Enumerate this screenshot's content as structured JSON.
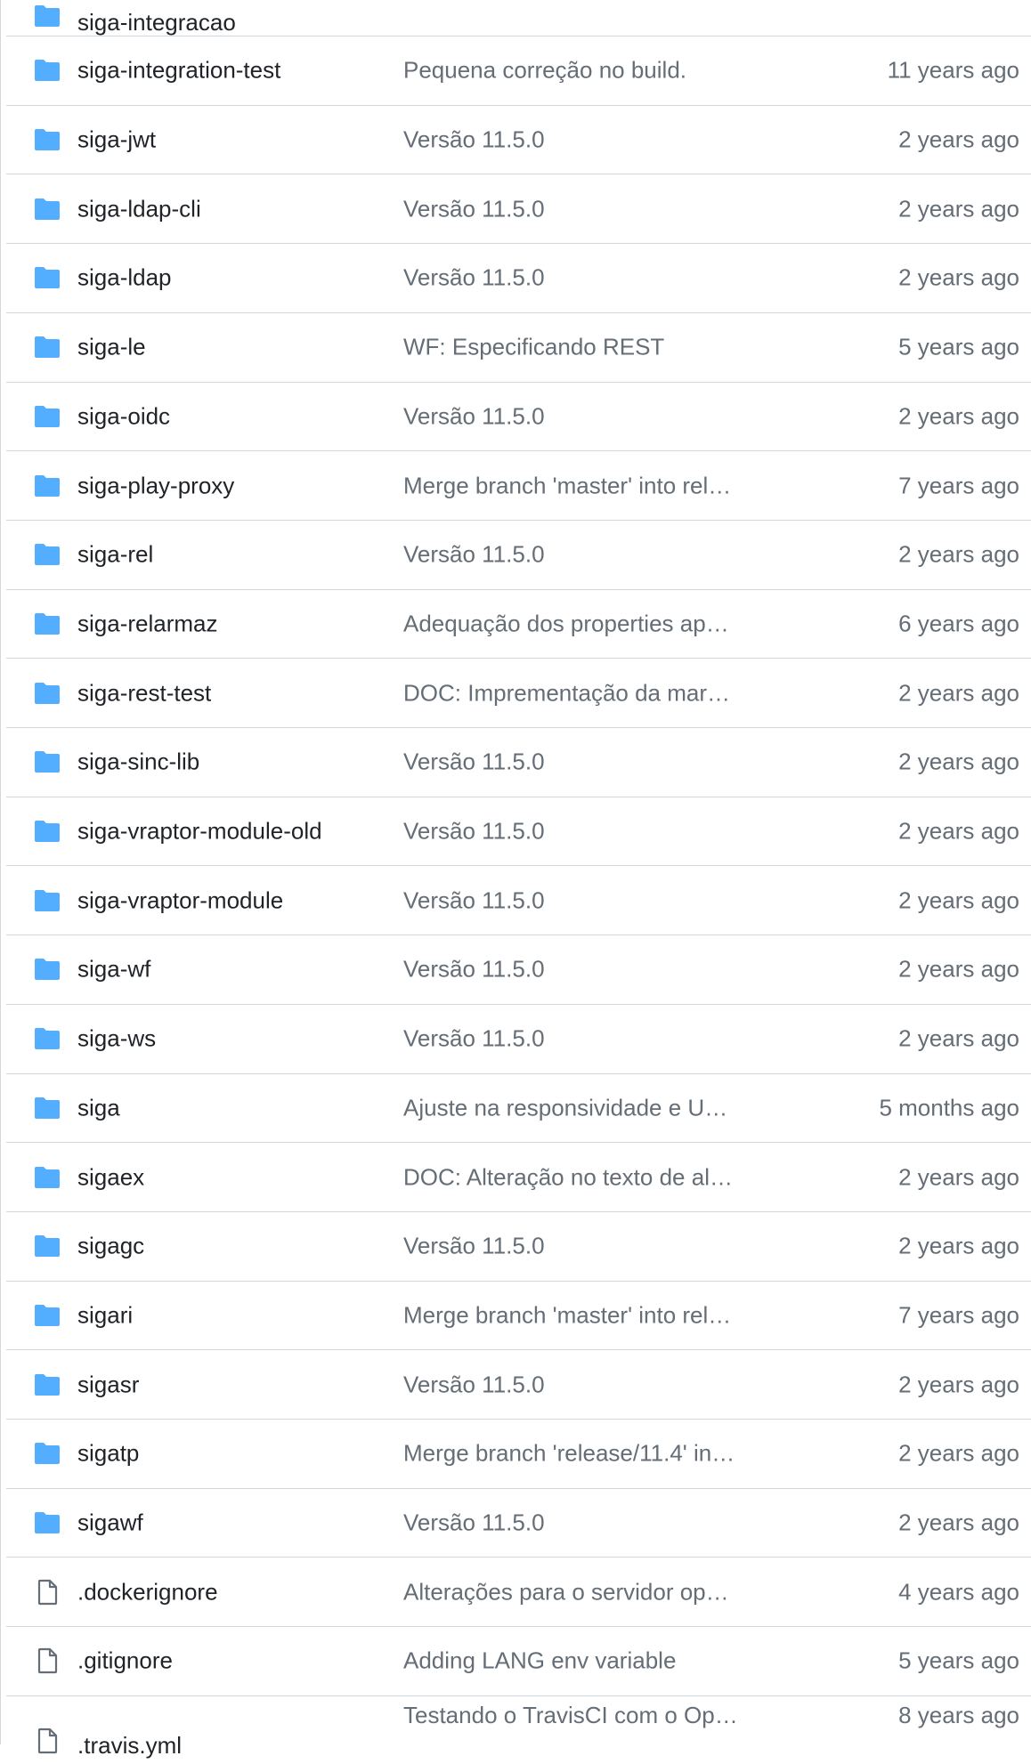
{
  "colors": {
    "folder_icon": "#54aeff",
    "file_icon": "#656d76",
    "border": "#d0d7de",
    "text_primary": "#1f2328",
    "text_muted": "#656d76"
  },
  "partial_top_item": {
    "name": "siga-integracao",
    "icon": "folder-icon"
  },
  "rows": [
    {
      "name": "siga-integration-test",
      "icon": "folder-icon",
      "message": "Pequena correção no build.",
      "age": "11 years ago"
    },
    {
      "name": "siga-jwt",
      "icon": "folder-icon",
      "message": "Versão 11.5.0",
      "age": "2 years ago"
    },
    {
      "name": "siga-ldap-cli",
      "icon": "folder-icon",
      "message": "Versão 11.5.0",
      "age": "2 years ago"
    },
    {
      "name": "siga-ldap",
      "icon": "folder-icon",
      "message": "Versão 11.5.0",
      "age": "2 years ago"
    },
    {
      "name": "siga-le",
      "icon": "folder-icon",
      "message": "WF: Especificando REST",
      "age": "5 years ago"
    },
    {
      "name": "siga-oidc",
      "icon": "folder-icon",
      "message": "Versão 11.5.0",
      "age": "2 years ago"
    },
    {
      "name": "siga-play-proxy",
      "icon": "folder-icon",
      "message": "Merge branch 'master' into rel…",
      "age": "7 years ago"
    },
    {
      "name": "siga-rel",
      "icon": "folder-icon",
      "message": "Versão 11.5.0",
      "age": "2 years ago"
    },
    {
      "name": "siga-relarmaz",
      "icon": "folder-icon",
      "message": "Adequação dos properties ap…",
      "age": "6 years ago"
    },
    {
      "name": "siga-rest-test",
      "icon": "folder-icon",
      "message": "DOC: Imprementação da mar…",
      "age": "2 years ago"
    },
    {
      "name": "siga-sinc-lib",
      "icon": "folder-icon",
      "message": "Versão 11.5.0",
      "age": "2 years ago"
    },
    {
      "name": "siga-vraptor-module-old",
      "icon": "folder-icon",
      "message": "Versão 11.5.0",
      "age": "2 years ago"
    },
    {
      "name": "siga-vraptor-module",
      "icon": "folder-icon",
      "message": "Versão 11.5.0",
      "age": "2 years ago"
    },
    {
      "name": "siga-wf",
      "icon": "folder-icon",
      "message": "Versão 11.5.0",
      "age": "2 years ago"
    },
    {
      "name": "siga-ws",
      "icon": "folder-icon",
      "message": "Versão 11.5.0",
      "age": "2 years ago"
    },
    {
      "name": "siga",
      "icon": "folder-icon",
      "message": "Ajuste na responsividade e U…",
      "age": "5 months ago"
    },
    {
      "name": "sigaex",
      "icon": "folder-icon",
      "message": "DOC: Alteração no texto de al…",
      "age": "2 years ago"
    },
    {
      "name": "sigagc",
      "icon": "folder-icon",
      "message": "Versão 11.5.0",
      "age": "2 years ago"
    },
    {
      "name": "sigari",
      "icon": "folder-icon",
      "message": "Merge branch 'master' into rel…",
      "age": "7 years ago"
    },
    {
      "name": "sigasr",
      "icon": "folder-icon",
      "message": "Versão 11.5.0",
      "age": "2 years ago"
    },
    {
      "name": "sigatp",
      "icon": "folder-icon",
      "message": "Merge branch 'release/11.4' in…",
      "age": "2 years ago"
    },
    {
      "name": "sigawf",
      "icon": "folder-icon",
      "message": "Versão 11.5.0",
      "age": "2 years ago"
    },
    {
      "name": ".dockerignore",
      "icon": "file-icon",
      "message": "Alterações para o servidor op…",
      "age": "4 years ago"
    },
    {
      "name": ".gitignore",
      "icon": "file-icon",
      "message": "Adding LANG env variable",
      "age": "5 years ago"
    },
    {
      "name": ".travis.yml",
      "icon": "file-icon",
      "message": "Testando o TravisCI com o Op…",
      "age": "8 years ago"
    }
  ]
}
